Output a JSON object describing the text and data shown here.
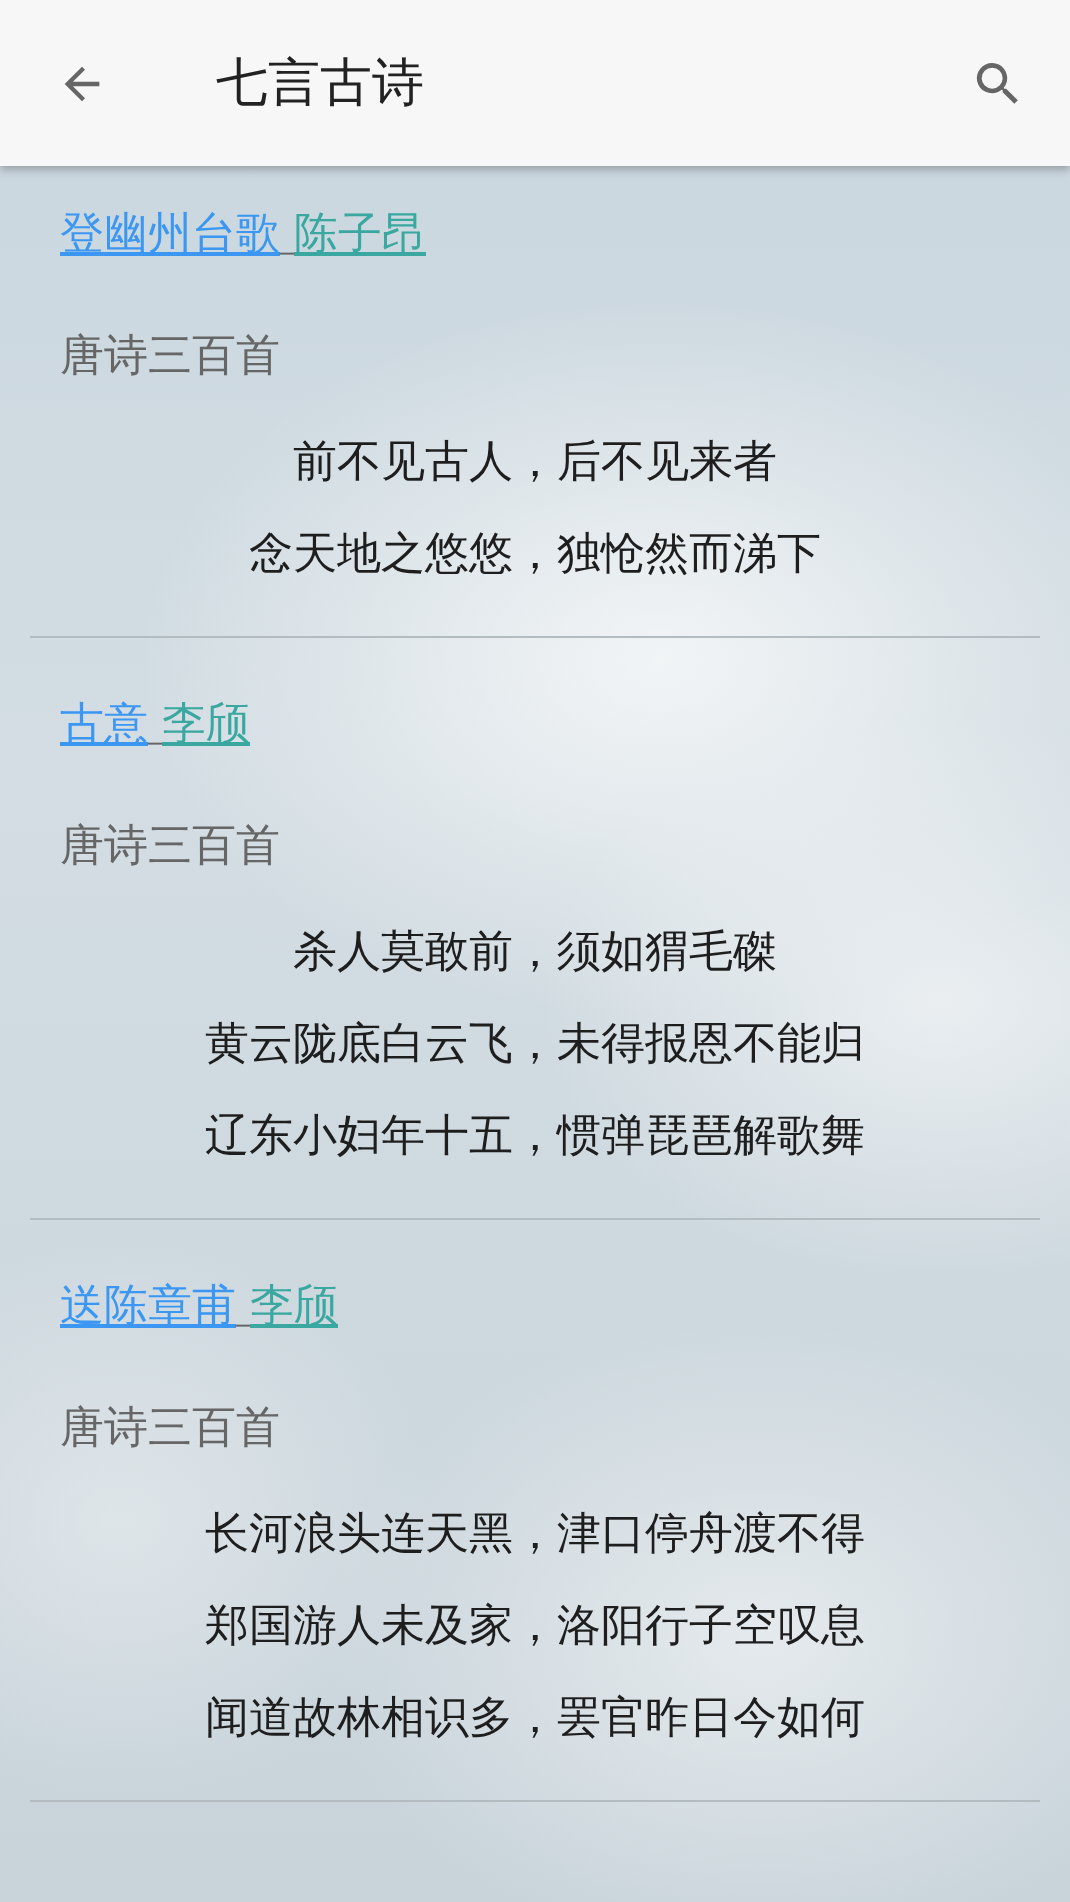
{
  "toolbar": {
    "title": "七言古诗"
  },
  "poems": [
    {
      "title": "登幽州台歌",
      "separator": "_",
      "author": "陈子昂",
      "source": "唐诗三百首",
      "lines": [
        "前不见古人，后不见来者",
        "念天地之悠悠，独怆然而涕下"
      ]
    },
    {
      "title": "古意",
      "separator": "_",
      "author": "李颀",
      "source": "唐诗三百首",
      "lines": [
        "杀人莫敢前，须如猬毛磔",
        "黄云陇底白云飞，未得报恩不能归",
        "辽东小妇年十五，惯弹琵琶解歌舞"
      ]
    },
    {
      "title": "送陈章甫",
      "separator": "_",
      "author": "李颀",
      "source": "唐诗三百首",
      "lines": [
        "长河浪头连天黑，津口停舟渡不得",
        "郑国游人未及家，洛阳行子空叹息",
        "闻道故林相识多，罢官昨日今如何"
      ]
    }
  ]
}
